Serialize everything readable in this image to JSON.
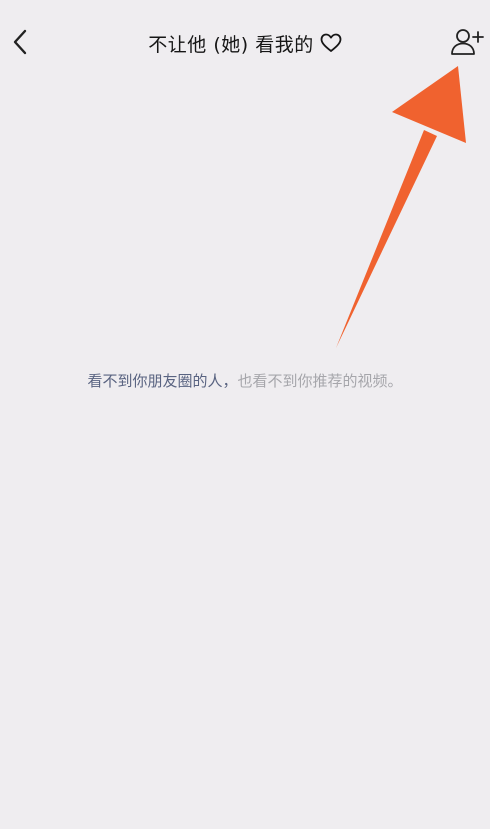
{
  "nav": {
    "back_icon": "chevron-left-icon",
    "title": "不让他 (她) 看我的",
    "title_icon": "heart-outline-icon",
    "add_icon": "add-contact-icon"
  },
  "hint": {
    "primary": "看不到你朋友圈的人，",
    "secondary": "也看不到你推荐的视频。"
  },
  "colors": {
    "background": "#efedf0",
    "title": "#161616",
    "hint_primary": "#596381",
    "hint_secondary": "#a6a6ab",
    "annotation_arrow": "#f0622f"
  }
}
